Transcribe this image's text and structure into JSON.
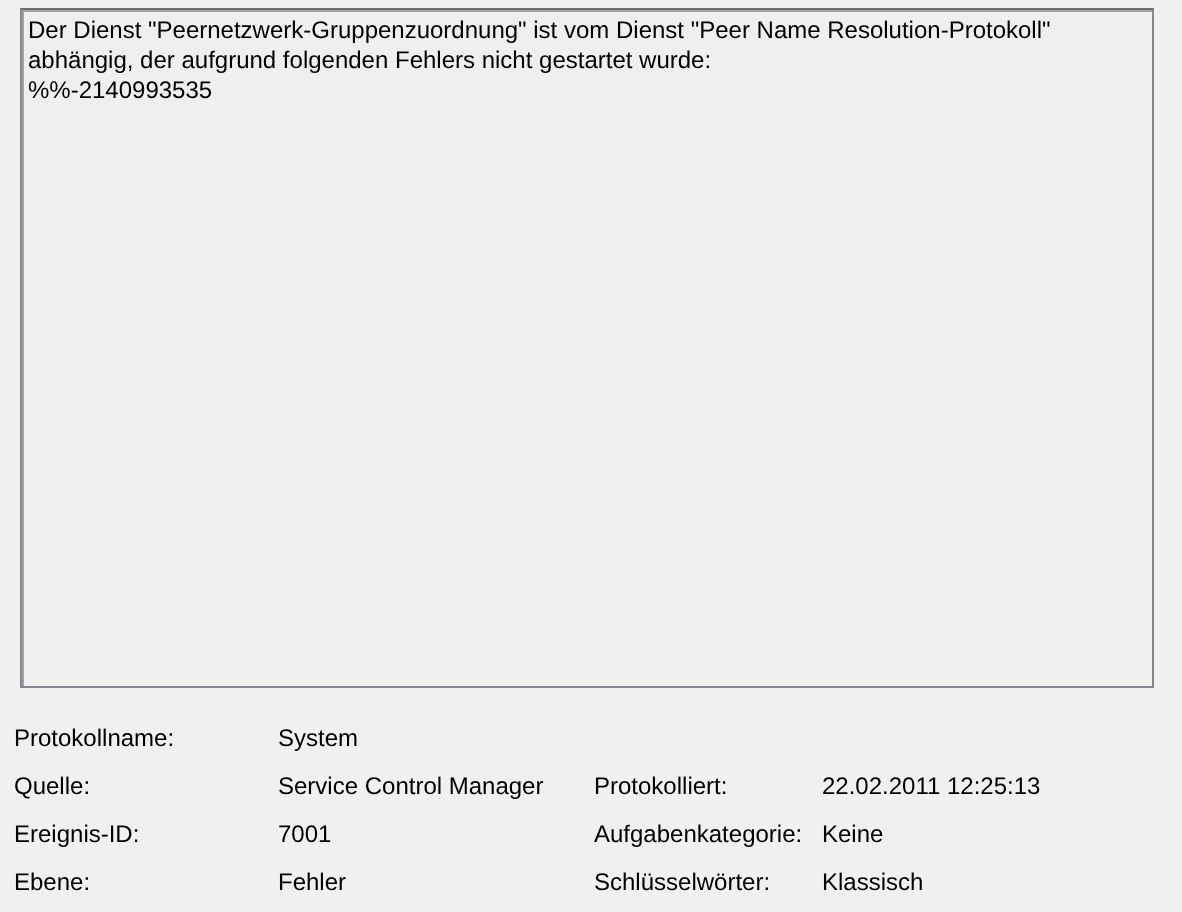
{
  "message": {
    "lines": [
      "Der Dienst \"Peernetzwerk-Gruppenzuordnung\" ist vom Dienst \"Peer Name Resolution-Protokoll\"",
      "abhängig, der aufgrund folgenden Fehlers nicht gestartet wurde:",
      "%%-2140993535"
    ]
  },
  "details": [
    {
      "label": "Protokollname:",
      "value": "System"
    },
    {
      "label": "Quelle:",
      "value": "Service Control Manager",
      "label_2": "Protokolliert:",
      "value_2": "22.02.2011 12:25:13"
    },
    {
      "label": "Ereignis-ID:",
      "value": "7001",
      "label_2": "Aufgabenkategorie:",
      "value_2": "Keine"
    },
    {
      "label": "Ebene:",
      "value": "Fehler",
      "label_2": "Schlüsselwörter:",
      "value_2": "Klassisch"
    }
  ]
}
